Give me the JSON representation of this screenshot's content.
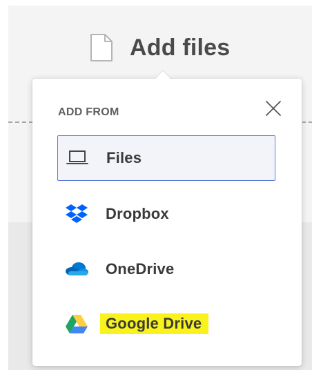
{
  "header": {
    "title": "Add files",
    "icon": "document-icon"
  },
  "popup": {
    "section_label": "ADD FROM",
    "close_icon": "close-icon",
    "options": [
      {
        "label": "Files",
        "icon": "laptop-icon",
        "selected": true
      },
      {
        "label": "Dropbox",
        "icon": "dropbox-icon",
        "selected": false
      },
      {
        "label": "OneDrive",
        "icon": "onedrive-icon",
        "selected": false
      },
      {
        "label": "Google Drive",
        "icon": "google-drive-icon",
        "selected": false,
        "highlighted": true
      }
    ]
  },
  "colors": {
    "selected_border": "#5b78d6",
    "highlight": "#f9f21d",
    "dropbox": "#0061fe",
    "onedrive": "#0364b8"
  }
}
